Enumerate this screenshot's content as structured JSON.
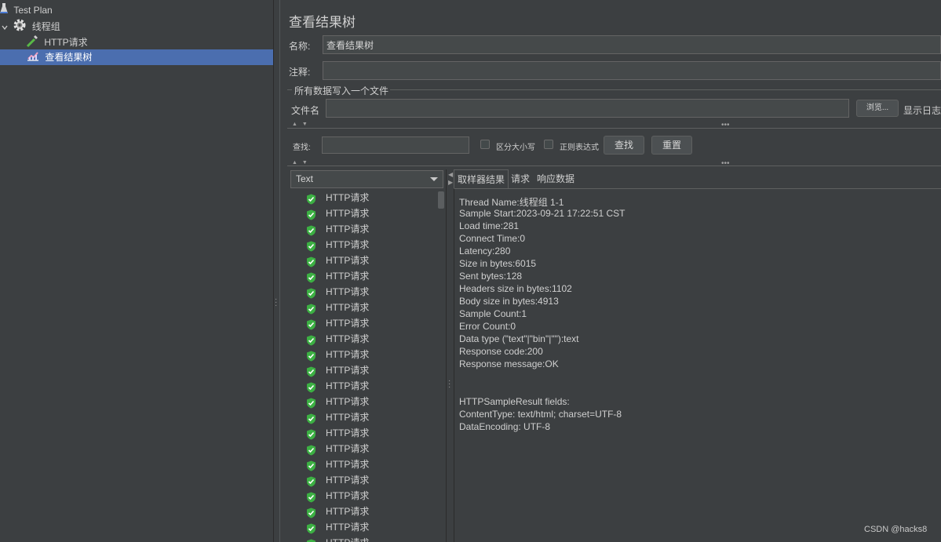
{
  "tree": {
    "nodes": [
      {
        "label": "Test Plan",
        "icon": "flask-icon",
        "level": 0
      },
      {
        "label": "线程组",
        "icon": "gear-icon",
        "level": 1
      },
      {
        "label": "HTTP请求",
        "icon": "pipette-icon",
        "level": 2
      },
      {
        "label": "查看结果树",
        "icon": "chart-icon",
        "level": 2,
        "selected": true
      }
    ]
  },
  "panel": {
    "title": "查看结果树",
    "name_label": "名称:",
    "name_value": "查看结果树",
    "comment_label": "注释:",
    "comment_value": "",
    "file_group_label": "所有数据写入一个文件",
    "file_label": "文件名",
    "file_value": "",
    "browse_label": "浏览...",
    "log_label": "显示日志"
  },
  "search": {
    "label": "查找:",
    "value": "",
    "case_label": "区分大小写",
    "case_checked": false,
    "regex_label": "正则表达式",
    "regex_checked": false,
    "find_button": "查找",
    "reset_button": "重置"
  },
  "renderer": {
    "selected": "Text"
  },
  "results": {
    "item_label": "HTTP请求",
    "count": 23,
    "status": "success"
  },
  "tabs": [
    "取样器结果",
    "请求",
    "响应数据"
  ],
  "active_tab": 0,
  "sampler_result": [
    "Thread Name:线程组 1-1",
    "Sample Start:2023-09-21 17:22:51 CST",
    "Load time:281",
    "Connect Time:0",
    "Latency:280",
    "Size in bytes:6015",
    "Sent bytes:128",
    "Headers size in bytes:1102",
    "Body size in bytes:4913",
    "Sample Count:1",
    "Error Count:0",
    "Data type (\"text\"|\"bin\"|\"\"):text",
    "Response code:200",
    "Response message:OK",
    "",
    "",
    "HTTPSampleResult fields:",
    "ContentType: text/html; charset=UTF-8",
    "DataEncoding: UTF-8"
  ],
  "watermark": "CSDN @hacks8",
  "colors": {
    "background": "#3c3f41",
    "selection": "#4b6eaf",
    "success_green": "#3cb043"
  }
}
